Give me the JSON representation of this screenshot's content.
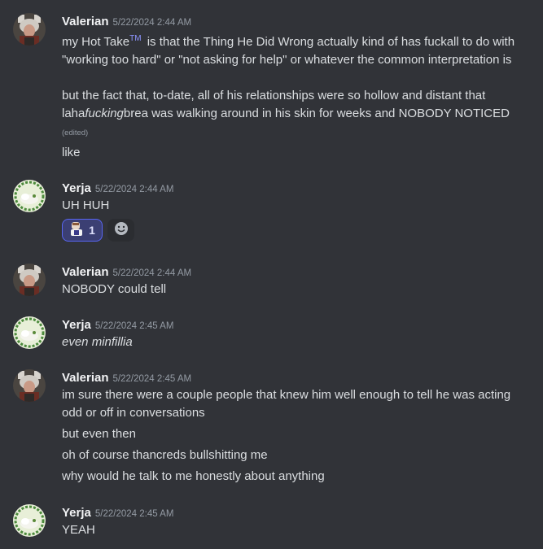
{
  "messages": [
    {
      "author": "Valerian",
      "timestamp": "5/22/2024 2:44 AM",
      "lines": [
        {
          "pre": "my Hot Take",
          "tm": "TM",
          "post": "is that the Thing He Did Wrong actually kind of has fuckall to do with \"working too hard\" or \"not asking for help\" or whatever the common interpretation is"
        },
        {
          "pre": "but the fact that, to-date, all of his relationships were so hollow and distant that laha",
          "em": "fucking",
          "post": "brea was walking around in his skin for weeks and NOBODY NOTICED"
        },
        {
          "text": "like"
        }
      ],
      "edited_label": "(edited)"
    },
    {
      "author": "Yerja",
      "timestamp": "5/22/2024 2:44 AM",
      "lines": [
        {
          "text": "UH HUH"
        }
      ],
      "reaction": {
        "count": "1",
        "icon": "character-emoji-icon"
      },
      "add_reaction_icon": "smiley-face-icon"
    },
    {
      "author": "Valerian",
      "timestamp": "5/22/2024 2:44 AM",
      "lines": [
        {
          "text": "NOBODY could tell"
        }
      ]
    },
    {
      "author": "Yerja",
      "timestamp": "5/22/2024 2:45 AM",
      "lines": [
        {
          "text": "even minfillia"
        }
      ]
    },
    {
      "author": "Valerian",
      "timestamp": "5/22/2024 2:45 AM",
      "lines": [
        {
          "text": "im sure there were a couple people that knew him well enough to tell he was acting odd or off in conversations"
        },
        {
          "text": "but even then"
        },
        {
          "text": "oh of course thancreds bullshitting me"
        },
        {
          "text": "why would he talk to me honestly about anything"
        }
      ]
    },
    {
      "author": "Yerja",
      "timestamp": "5/22/2024 2:45 AM",
      "lines": [
        {
          "text": "YEAH"
        }
      ]
    }
  ],
  "colors": {
    "background": "#313338",
    "text": "#dbdee1",
    "timestamp": "#949ba4",
    "reaction_bg": "#3b3f73",
    "reaction_border": "#5865f2"
  }
}
